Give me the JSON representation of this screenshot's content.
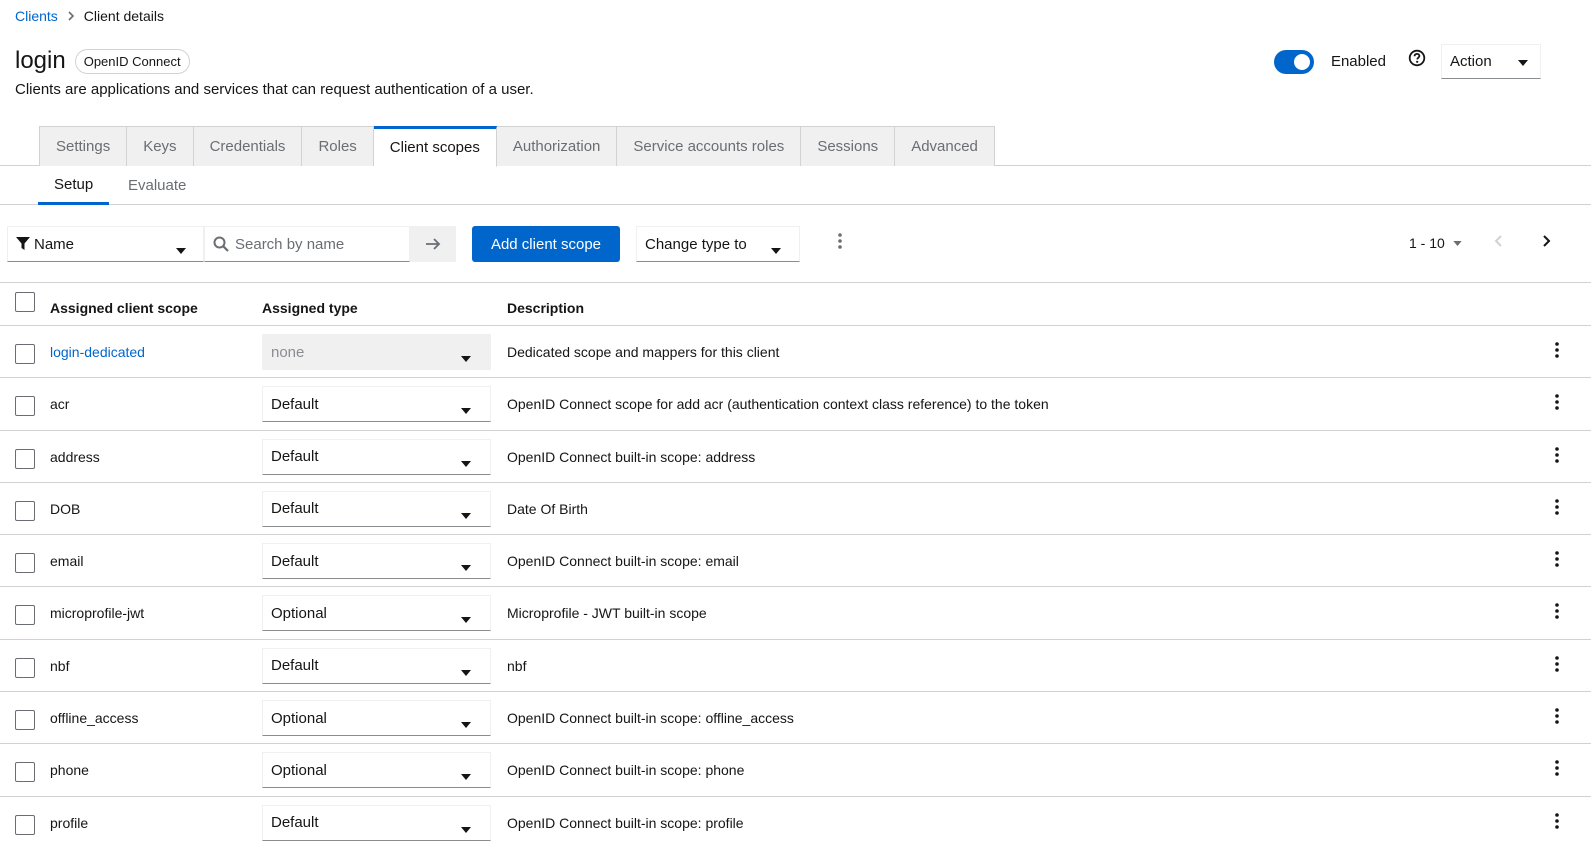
{
  "breadcrumb": {
    "parent": "Clients",
    "current": "Client details"
  },
  "header": {
    "title": "login",
    "badge": "OpenID Connect",
    "subtitle": "Clients are applications and services that can request authentication of a user.",
    "enabled_label": "Enabled",
    "enabled": true,
    "action_label": "Action"
  },
  "tabs": [
    {
      "label": "Settings",
      "active": false
    },
    {
      "label": "Keys",
      "active": false
    },
    {
      "label": "Credentials",
      "active": false
    },
    {
      "label": "Roles",
      "active": false
    },
    {
      "label": "Client scopes",
      "active": true
    },
    {
      "label": "Authorization",
      "active": false
    },
    {
      "label": "Service accounts roles",
      "active": false
    },
    {
      "label": "Sessions",
      "active": false
    },
    {
      "label": "Advanced",
      "active": false
    }
  ],
  "subtabs": [
    {
      "label": "Setup",
      "active": true
    },
    {
      "label": "Evaluate",
      "active": false
    }
  ],
  "toolbar": {
    "filter_label": "Name",
    "search_placeholder": "Search by name",
    "add_button": "Add client scope",
    "change_type_label": "Change type to",
    "pagination": "1 - 10"
  },
  "table": {
    "headers": {
      "name": "Assigned client scope",
      "type": "Assigned type",
      "description": "Description"
    },
    "rows": [
      {
        "name": "login-dedicated",
        "type": "none",
        "description": "Dedicated scope and mappers for this client"
      },
      {
        "name": "acr",
        "type": "Default",
        "description": "OpenID Connect scope for add acr (authentication context class reference) to the token"
      },
      {
        "name": "address",
        "type": "Default",
        "description": "OpenID Connect built-in scope: address"
      },
      {
        "name": "DOB",
        "type": "Default",
        "description": "Date Of Birth"
      },
      {
        "name": "email",
        "type": "Default",
        "description": "OpenID Connect built-in scope: email"
      },
      {
        "name": "microprofile-jwt",
        "type": "Optional",
        "description": "Microprofile - JWT built-in scope"
      },
      {
        "name": "nbf",
        "type": "Default",
        "description": "nbf"
      },
      {
        "name": "offline_access",
        "type": "Optional",
        "description": "OpenID Connect built-in scope: offline_access"
      },
      {
        "name": "phone",
        "type": "Optional",
        "description": "OpenID Connect built-in scope: phone"
      },
      {
        "name": "profile",
        "type": "Default",
        "description": "OpenID Connect built-in scope: profile"
      }
    ]
  },
  "colors": {
    "accent": "#0066cc",
    "text": "#151515",
    "muted": "#6a6e73",
    "border": "#d2d2d2"
  }
}
